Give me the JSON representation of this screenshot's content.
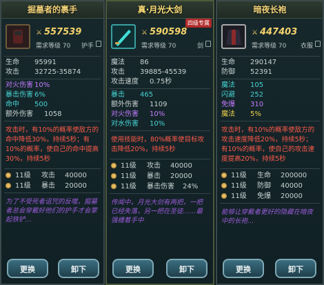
{
  "panels": [
    {
      "title": "掘墓者的裹手",
      "power": "557539",
      "req_level": "需求等级 70",
      "slot": "护手",
      "stats": [
        {
          "k": "生命",
          "v": "95991"
        },
        {
          "k": "攻击",
          "v": "32725-35874"
        }
      ],
      "stats2": [
        {
          "k": "对火伤害",
          "v": "10%",
          "color": "c-purple"
        },
        {
          "k": "暴击伤害",
          "v": "6%",
          "color": "c-cyan"
        },
        {
          "k": "命中",
          "v": "500",
          "color": "c-cyan"
        },
        {
          "k": "额外伤害",
          "v": "1058",
          "color": ""
        }
      ],
      "desc": "攻击时，有10%的概率使敌方的命中降低30%，持续5秒；有10%的概率，使自己的命中提高30%，持续5秒",
      "gems": [
        {
          "lv": "11级",
          "stat": "攻击",
          "val": "40000"
        },
        {
          "lv": "11级",
          "stat": "暴击",
          "val": "20000"
        }
      ],
      "flavor": "为了不受死者诅咒的反噬，掘墓者总会穿戴好他们的护手才会掌起铁铲…",
      "btn_replace": "更换",
      "btn_remove": "卸下"
    },
    {
      "title": "真·月光大剑",
      "badge": "四级专属",
      "power": "590598",
      "req_level": "需求等级 70",
      "slot": "剑",
      "stats": [
        {
          "k": "魔法",
          "v": "86"
        },
        {
          "k": "攻击",
          "v": "39885-45539"
        },
        {
          "k": "攻击速度",
          "v": "0.75秒"
        }
      ],
      "stats2": [
        {
          "k": "暴击",
          "v": "465",
          "color": "c-cyan"
        },
        {
          "k": "额外伤害",
          "v": "1109",
          "color": ""
        },
        {
          "k": "对火伤害",
          "v": "10%",
          "color": "c-purple"
        },
        {
          "k": "对水伤害",
          "v": "10%",
          "color": "c-cyan"
        }
      ],
      "desc": "使用技能时，80%概率使目标攻击降低20%，持续5秒",
      "gems": [
        {
          "lv": "11级",
          "stat": "攻击",
          "val": "40000"
        },
        {
          "lv": "11级",
          "stat": "暴击",
          "val": "20000"
        },
        {
          "lv": "11级",
          "stat": "暴击伤害",
          "val": "24%"
        }
      ],
      "flavor": "传闻中，月光大剑有两把，一把已经失落，另一把在圣徒……最强缠着手中",
      "btn_replace": "更换",
      "btn_remove": "卸下"
    },
    {
      "title": "暗夜长袍",
      "power": "447403",
      "req_level": "需求等级 70",
      "slot": "衣服",
      "stats": [
        {
          "k": "生命",
          "v": "290147"
        },
        {
          "k": "防御",
          "v": "52391"
        }
      ],
      "stats2": [
        {
          "k": "魔法",
          "v": "105",
          "color": "c-cyan"
        },
        {
          "k": "闪避",
          "v": "252",
          "color": "c-cyan"
        },
        {
          "k": "免爆",
          "v": "310",
          "color": "c-purple"
        },
        {
          "k": "魔法",
          "v": "5%",
          "color": "c-yellow"
        }
      ],
      "desc": "攻击时，有10%的概率使敌方的攻击速度降低20%，持续5秒；有10%的概率，使自己的攻击速度提高20%，持续5秒",
      "gems": [
        {
          "lv": "11级",
          "stat": "生命",
          "val": "200000"
        },
        {
          "lv": "11级",
          "stat": "防御",
          "val": "40000"
        },
        {
          "lv": "11级",
          "stat": "免爆",
          "val": "20000"
        }
      ],
      "flavor": "能够让穿戴者更好的隐藏在暗夜中的长袍…",
      "btn_replace": "更换",
      "btn_remove": "卸下"
    }
  ]
}
